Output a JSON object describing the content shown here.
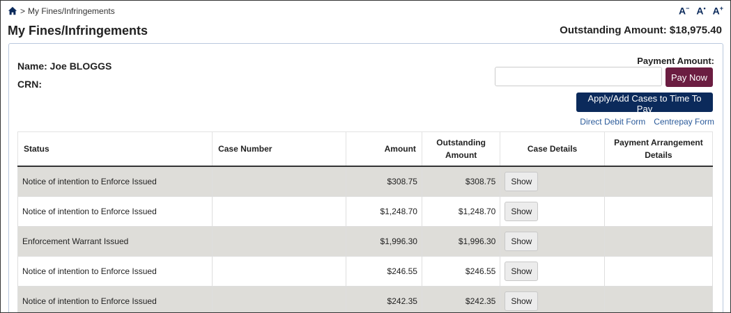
{
  "breadcrumb": {
    "separator": ">",
    "current": "My Fines/Infringements"
  },
  "font_controls": {
    "decrease": "A",
    "decrease_sup": "−",
    "reset": "A",
    "reset_sup": "•",
    "increase": "A",
    "increase_sup": "+"
  },
  "page": {
    "title": "My Fines/Infringements",
    "outstanding_label": "Outstanding Amount: $18,975.40"
  },
  "profile": {
    "name_label": "Name: Joe BLOGGS",
    "crn_label": "CRN:"
  },
  "payment": {
    "label": "Payment Amount:",
    "input_value": "",
    "pay_button": "Pay Now",
    "apply_button": "Apply/Add Cases to Time To Pay",
    "links": [
      "Direct Debit Form",
      "Centrepay Form"
    ]
  },
  "table": {
    "headers": {
      "status": "Status",
      "case_number": "Case Number",
      "amount": "Amount",
      "outstanding": "Outstanding Amount",
      "case_details": "Case Details",
      "arrangement": "Payment Arrangement Details"
    },
    "show_label": "Show",
    "rows": [
      {
        "status": "Notice of intention to Enforce Issued",
        "case_number": "",
        "amount": "$308.75",
        "outstanding": "$308.75",
        "arrangement": ""
      },
      {
        "status": "Notice of intention to Enforce Issued",
        "case_number": "",
        "amount": "$1,248.70",
        "outstanding": "$1,248.70",
        "arrangement": ""
      },
      {
        "status": "Enforcement Warrant Issued",
        "case_number": "",
        "amount": "$1,996.30",
        "outstanding": "$1,996.30",
        "arrangement": ""
      },
      {
        "status": "Notice of intention to Enforce Issued",
        "case_number": "",
        "amount": "$246.55",
        "outstanding": "$246.55",
        "arrangement": ""
      },
      {
        "status": "Notice of intention to Enforce Issued",
        "case_number": "",
        "amount": "$242.35",
        "outstanding": "$242.35",
        "arrangement": ""
      }
    ]
  },
  "colors": {
    "brand_navy": "#0b2a5b",
    "pay_maroon": "#6b1d41",
    "row_shade": "#deddd9",
    "link_blue": "#2a5a9a"
  }
}
